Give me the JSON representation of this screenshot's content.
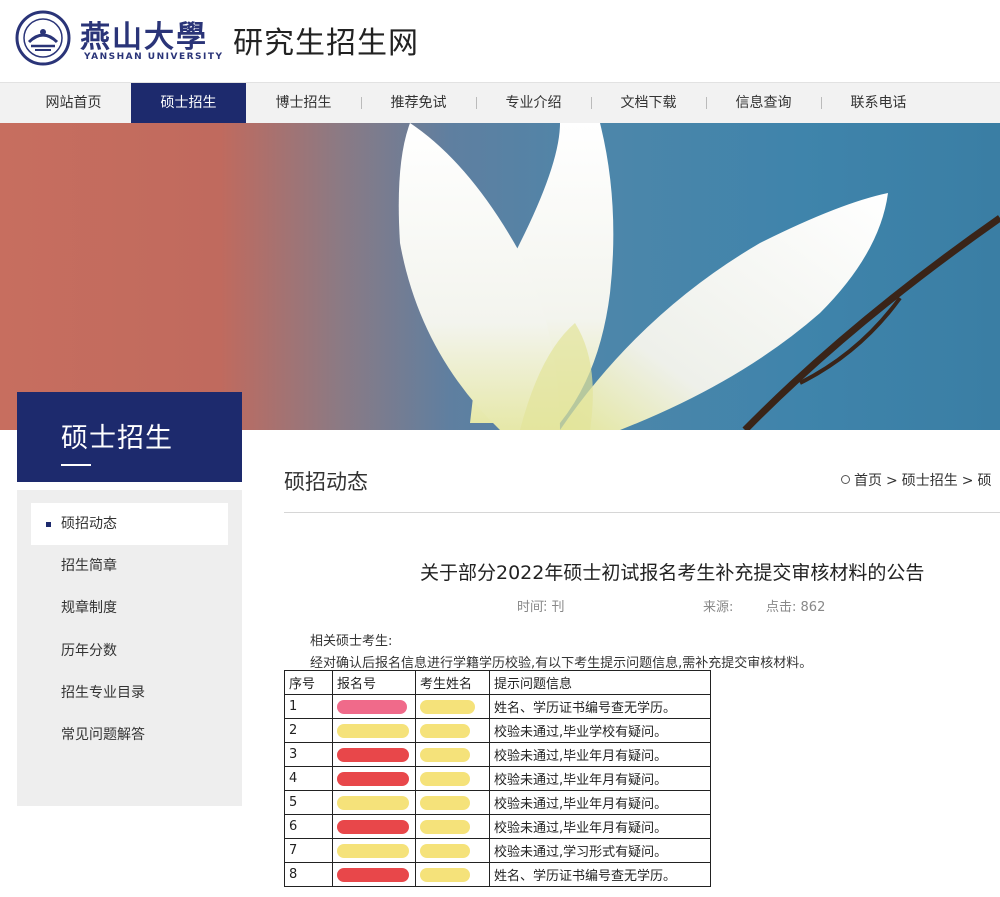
{
  "header": {
    "logo_cn": "燕山大學",
    "logo_en": "YANSHAN UNIVERSITY",
    "site_name": "研究生招生网"
  },
  "nav": {
    "items": [
      "网站首页",
      "硕士招生",
      "博士招生",
      "推荐免试",
      "专业介绍",
      "文档下载",
      "信息查询",
      "联系电话"
    ],
    "active_index": 1
  },
  "sidebar": {
    "title": "硕士招生",
    "items": [
      "硕招动态",
      "招生简章",
      "规章制度",
      "历年分数",
      "招生专业目录",
      "常见问题解答"
    ],
    "active_index": 0
  },
  "main": {
    "section_title": "硕招动态",
    "breadcrumb": [
      "首页",
      "硕士招生",
      "硕"
    ],
    "article": {
      "title": "关于部分2022年硕士初试报名考生补充提交审核材料的公告",
      "time_label": "时间:",
      "time_value": "̈ 刊",
      "source_label": "来源:",
      "clicks_label": "点击:",
      "clicks_value": "862",
      "greeting": "相关硕士考生:",
      "intro": "经对确认后报名信息进行学籍学历校验,有以下考生提示问题信息,需补充提交审核材料。"
    },
    "table": {
      "headers": [
        "序号",
        "报名号",
        "考生姓名",
        "提示问题信息"
      ],
      "rows": [
        {
          "no": "1",
          "issue": "姓名、学历证书编号查无学历。"
        },
        {
          "no": "2",
          "issue": "校验未通过,毕业学校有疑问。"
        },
        {
          "no": "3",
          "issue": "校验未通过,毕业年月有疑问。"
        },
        {
          "no": "4",
          "issue": "校验未通过,毕业年月有疑问。"
        },
        {
          "no": "5",
          "issue": "校验未通过,毕业年月有疑问。"
        },
        {
          "no": "6",
          "issue": "校验未通过,毕业年月有疑问。"
        },
        {
          "no": "7",
          "issue": "校验未通过,学习形式有疑问。"
        },
        {
          "no": "8",
          "issue": "姓名、学历证书编号查无学历。"
        }
      ]
    }
  },
  "colors": {
    "brand_navy": "#1d2a6d",
    "redact_red": "#e8474a",
    "redact_yellow": "#f5e27a"
  }
}
